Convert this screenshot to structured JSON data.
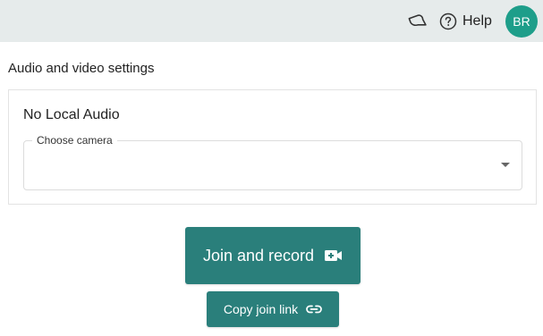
{
  "header": {
    "notifications_icon": "bell-outline-icon",
    "help_icon": "question-circle-icon",
    "help_label": "Help",
    "avatar_initials": "BR",
    "avatar_color": "#1e9e8a",
    "background_color": "#e6ebeb"
  },
  "settings": {
    "title": "Audio and video settings",
    "audio_status": "No Local Audio",
    "camera_select": {
      "label": "Choose camera",
      "value": ""
    }
  },
  "actions": {
    "join_label": "Join and record",
    "join_icon": "video-camera-plus-icon",
    "copy_label": "Copy join link",
    "copy_icon": "link-icon",
    "accent_color": "#2a7f7b"
  }
}
